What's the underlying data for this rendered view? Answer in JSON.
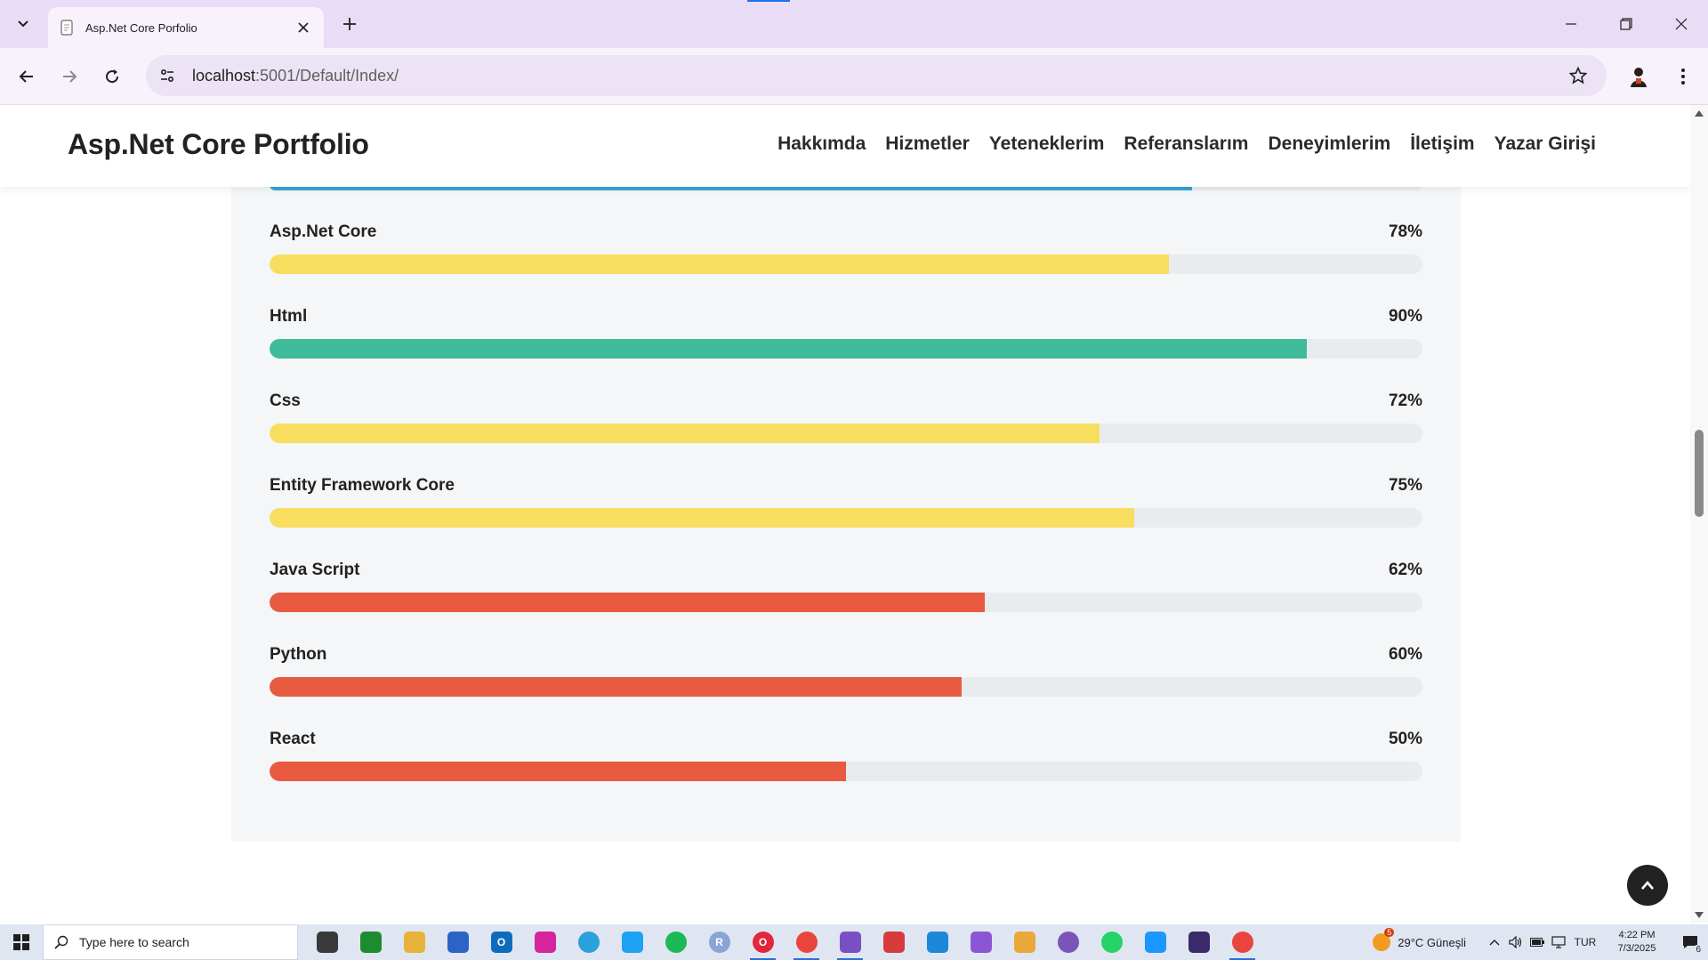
{
  "browser": {
    "tab_title": "Asp.Net Core Porfolio",
    "url_host": "localhost",
    "url_rest": ":5001/Default/Index/"
  },
  "site": {
    "logo": "Asp.Net Core Portfolio",
    "nav": [
      "Hakkımda",
      "Hizmetler",
      "Yeteneklerim",
      "Referanslarım",
      "Deneyimlerim",
      "İletişim",
      "Yazar Girişi"
    ]
  },
  "skills": [
    {
      "name": "Asp.Net Core",
      "percent_label": "78%",
      "value": 78,
      "color": "#f7de5e"
    },
    {
      "name": "Html",
      "percent_label": "90%",
      "value": 90,
      "color": "#3fba9b"
    },
    {
      "name": "Css",
      "percent_label": "72%",
      "value": 72,
      "color": "#f7de5e"
    },
    {
      "name": "Entity Framework Core",
      "percent_label": "75%",
      "value": 75,
      "color": "#f7de5e"
    },
    {
      "name": "Java Script",
      "percent_label": "62%",
      "value": 62,
      "color": "#e85b41"
    },
    {
      "name": "Python",
      "percent_label": "60%",
      "value": 60,
      "color": "#e85b41"
    },
    {
      "name": "React",
      "percent_label": "50%",
      "value": 50,
      "color": "#e85b41"
    }
  ],
  "top_partial_bar": {
    "value": 80,
    "color": "#35a6d3"
  },
  "taskbar": {
    "search_placeholder": "Type here to search",
    "apps": [
      {
        "name": "task-view",
        "color": "#3a3a3a",
        "label": ""
      },
      {
        "name": "xbox",
        "color": "#1f8b2f",
        "label": ""
      },
      {
        "name": "file-explorer",
        "color": "#e8b23a",
        "label": ""
      },
      {
        "name": "microsoft-store",
        "color": "#2b64c6",
        "label": ""
      },
      {
        "name": "outlook",
        "color": "#0f6cbd",
        "label": "O"
      },
      {
        "name": "instagram",
        "color": "#d6249f",
        "label": ""
      },
      {
        "name": "telegram",
        "color": "#2aa1da",
        "label": ""
      },
      {
        "name": "twitter",
        "color": "#1da1f2",
        "label": ""
      },
      {
        "name": "spotify",
        "color": "#1db954",
        "label": ""
      },
      {
        "name": "r-app",
        "color": "#8aa4d6",
        "label": "R"
      },
      {
        "name": "opera",
        "color": "#e3263a",
        "label": "O"
      },
      {
        "name": "chrome",
        "color": "#e8453c",
        "label": ""
      },
      {
        "name": "visual-studio",
        "color": "#7b4fc4",
        "label": ""
      },
      {
        "name": "red-app",
        "color": "#d83b3b",
        "label": ""
      },
      {
        "name": "vscode",
        "color": "#1e88d8",
        "label": ""
      },
      {
        "name": "visual-studio-2",
        "color": "#8a56d6",
        "label": ""
      },
      {
        "name": "paint-app",
        "color": "#e8a93a",
        "label": ""
      },
      {
        "name": "tor-app",
        "color": "#7a54b8",
        "label": ""
      },
      {
        "name": "whatsapp",
        "color": "#25d366",
        "label": ""
      },
      {
        "name": "prime-video",
        "color": "#1a98ff",
        "label": ""
      },
      {
        "name": "terminal-app",
        "color": "#3b2a6b",
        "label": ""
      },
      {
        "name": "chrome-active",
        "color": "#e8453c",
        "label": ""
      }
    ],
    "weather_badge": "5",
    "weather": "29°C  Güneşli",
    "lang": "TUR",
    "time": "4:22 PM",
    "date": "7/3/2025",
    "notif_count": "6"
  }
}
